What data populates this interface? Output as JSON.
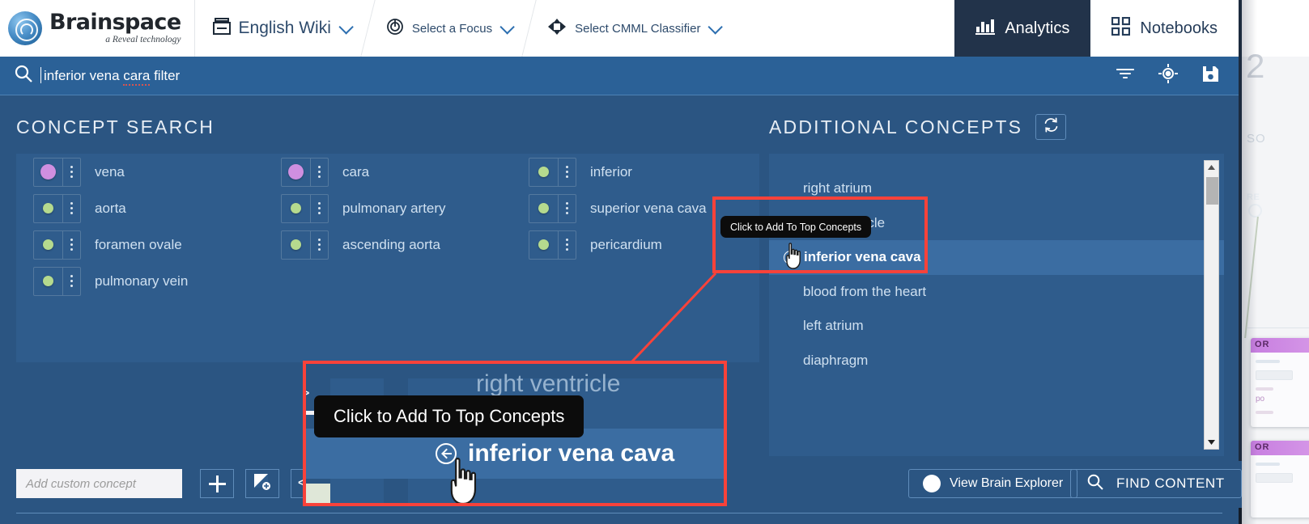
{
  "app": {
    "logo_name": "Brainspace",
    "logo_tagline": "a Reveal technology"
  },
  "header": {
    "dataset": {
      "label": "English Wiki",
      "icon": "dataset-icon"
    },
    "focus": {
      "label": "Select a Focus",
      "icon": "focus-target-icon"
    },
    "classifier": {
      "label": "Select CMML Classifier",
      "icon": "classifier-icon"
    },
    "tabs": [
      {
        "label": "Analytics",
        "icon": "bar-chart-icon",
        "active": true
      },
      {
        "label": "Notebooks",
        "icon": "grid-icon",
        "active": false
      }
    ]
  },
  "search": {
    "value": "inferior vena cara filter",
    "value_pre": "inferior vena ",
    "value_misspelled": "cara",
    "value_post": " filter",
    "icons": [
      "search-icon",
      "filter-icon",
      "target-icon",
      "save-icon"
    ]
  },
  "concept_search": {
    "title": "CONCEPT SEARCH",
    "columns": [
      [
        {
          "label": "vena",
          "dot": "purple"
        },
        {
          "label": "aorta",
          "dot": "green"
        },
        {
          "label": "foramen ovale",
          "dot": "green"
        },
        {
          "label": "pulmonary vein",
          "dot": "green"
        }
      ],
      [
        {
          "label": "cara",
          "dot": "purple"
        },
        {
          "label": "pulmonary artery",
          "dot": "green"
        },
        {
          "label": "ascending aorta",
          "dot": "green"
        }
      ],
      [
        {
          "label": "inferior",
          "dot": "green"
        },
        {
          "label": "superior vena cava",
          "dot": "green"
        },
        {
          "label": "pericardium",
          "dot": "green"
        }
      ]
    ]
  },
  "additional_concepts": {
    "title": "ADDITIONAL CONCEPTS",
    "refresh_icon": "refresh-search-icon",
    "items": [
      {
        "label": "right atrium",
        "highlighted": false
      },
      {
        "label": "right ventricle",
        "highlighted": false
      },
      {
        "label": "inferior vena cava",
        "highlighted": true
      },
      {
        "label": "blood from the heart",
        "highlighted": false
      },
      {
        "label": "left atrium",
        "highlighted": false
      },
      {
        "label": "diaphragm",
        "highlighted": false
      }
    ]
  },
  "toolbar": {
    "custom_concept_placeholder": "Add custom concept",
    "add_button": "+",
    "image_button_icon": "add-image-icon",
    "code_button_icon": "code-brackets-icon",
    "view_brain_explorer": "View Brain Explorer",
    "find_content": "FIND CONTENT"
  },
  "tooltip": {
    "text": "Click to Add To Top Concepts"
  },
  "callout": {
    "zoomed_label_above": "right ventricle",
    "zoomed_label": "inferior vena cava",
    "zoomed_tooltip": "Click to Add To Top Concepts"
  },
  "background_page": {
    "big_number": "2",
    "label_so": "SO",
    "label_re": "RE",
    "card_headers": [
      "OR",
      "OR"
    ],
    "card_text": "po"
  },
  "colors": {
    "modal_bg": "#2b5582",
    "panel_bg": "#2f5c8c",
    "header_bg": "#ffffff",
    "search_bg": "#2b6197",
    "active_tab_bg": "#22334a",
    "highlight_row": "#3b6da2",
    "accent_red": "#f9423a",
    "dot_purple": "#cf8fe0",
    "dot_green": "#b5da8e",
    "tooltip_bg": "#0c0c0c"
  }
}
